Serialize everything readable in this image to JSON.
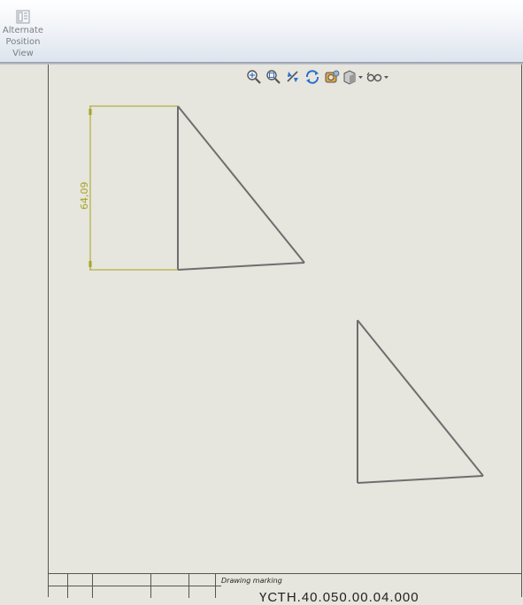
{
  "ribbon": {
    "alternate_position_view": {
      "line1": "Alternate",
      "line2": "Position",
      "line3": "View",
      "icon": "alternate-position-view-icon"
    }
  },
  "view_toolbar": [
    {
      "name": "zoom-to-fit-icon"
    },
    {
      "name": "zoom-to-area-icon"
    },
    {
      "name": "previous-view-icon"
    },
    {
      "name": "rotate-view-icon"
    },
    {
      "name": "3d-drawing-view-icon"
    },
    {
      "name": "display-style-icon",
      "dropdown": true
    },
    {
      "name": "hide-show-items-icon",
      "dropdown": true
    }
  ],
  "drawing": {
    "dimension": {
      "value": "64,09",
      "color": "#a7a31f"
    }
  },
  "title_block": {
    "drawing_marking_label": "Drawing marking",
    "document_code": "ҮСТН.40.050.00.04.000"
  },
  "colors": {
    "sheet": "#e6e5de",
    "lines": "#6e6e6e",
    "dimension": "#a7a31f"
  }
}
